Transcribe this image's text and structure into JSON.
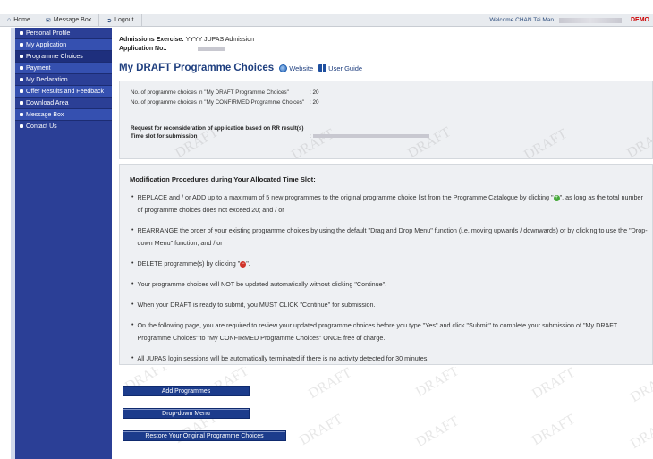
{
  "topbar": {
    "home": "Home",
    "message_box": "Message Box",
    "logout": "Logout",
    "welcome": "Welcome CHAN Tai Man",
    "demo": "DEMO"
  },
  "sidebar": {
    "items": [
      {
        "label": "Personal Profile"
      },
      {
        "label": "My Application"
      },
      {
        "label": "Programme Choices"
      },
      {
        "label": "Payment"
      },
      {
        "label": "My Declaration"
      },
      {
        "label": "Offer Results and Feedback"
      },
      {
        "label": "Download Area"
      },
      {
        "label": "Message Box"
      },
      {
        "label": "Contact Us"
      }
    ]
  },
  "meta": {
    "exercise_label": "Admissions Exercise:",
    "exercise_value": "YYYY JUPAS Admission",
    "app_no_label": "Application No.:"
  },
  "page": {
    "title": "My DRAFT Programme Choices",
    "website": "Website",
    "user_guide": "User Guide",
    "watermark": "DRAFT"
  },
  "info": {
    "draft_count_label": "No. of programme choices in \"My DRAFT Programme Choices\"",
    "draft_count_value": ": 20",
    "confirmed_count_label": "No. of programme choices in \"My CONFIRMED Programme Choices\"",
    "confirmed_count_value": ": 20",
    "reconsideration_label": "Request for reconsideration of application based on RR result(s)",
    "timeslot_label": "Time slot for submission",
    "timeslot_value": ":"
  },
  "procedures": {
    "heading": "Modification Procedures during Your Allocated Time Slot:",
    "items": [
      {
        "text_a": "REPLACE and / or ADD up to a maximum of 5 new programmes to the original programme choice list from the Programme Catalogue by clicking \"",
        "text_b": "\", as long as the total number of programme choices does not exceed 20; and / or"
      },
      {
        "text": "REARRANGE the order of your existing programme choices by using the default \"Drag and Drop Menu\" function (i.e. moving upwards / downwards) or by clicking to use the \"Drop-down Menu\" function; and / or"
      },
      {
        "text_a": "DELETE programme(s) by clicking \"",
        "text_b": "\"."
      },
      {
        "text": "Your programme choices will NOT be updated automatically without clicking \"Continue\"."
      },
      {
        "text": "When your DRAFT is ready to submit, you MUST CLICK \"Continue\" for submission."
      },
      {
        "text": "On the following page, you are required to review your updated programme choices before you type \"Yes\" and click \"Submit\" to complete your submission of \"My DRAFT Programme Choices\" to \"My CONFIRMED Programme Choices\" ONCE free of charge."
      },
      {
        "text": "All JUPAS login sessions will be automatically terminated if there is no activity detected for 30 minutes."
      }
    ]
  },
  "buttons": {
    "add": "Add Programmes",
    "dropdown": "Drop-down Menu",
    "restore": "Restore Your Original Programme Choices"
  }
}
